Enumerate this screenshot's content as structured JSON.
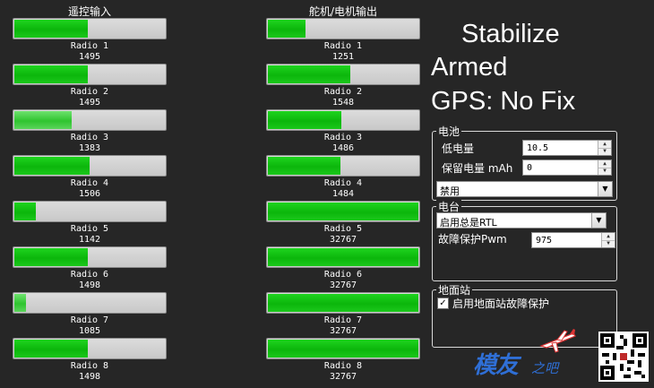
{
  "inputs": {
    "header": "遥控输入",
    "channels": [
      {
        "label": "Radio 1",
        "value": "1495",
        "fill": 0.49
      },
      {
        "label": "Radio 2",
        "value": "1495",
        "fill": 0.49
      },
      {
        "label": "Radio 3",
        "value": "1383",
        "fill": 0.38,
        "soft": true
      },
      {
        "label": "Radio 4",
        "value": "1506",
        "fill": 0.5
      },
      {
        "label": "Radio 5",
        "value": "1142",
        "fill": 0.14
      },
      {
        "label": "Radio 6",
        "value": "1498",
        "fill": 0.49
      },
      {
        "label": "Radio 7",
        "value": "1085",
        "fill": 0.08,
        "soft": true
      },
      {
        "label": "Radio 8",
        "value": "1498",
        "fill": 0.49
      }
    ]
  },
  "outputs": {
    "header": "舵机/电机输出",
    "channels": [
      {
        "label": "Radio 1",
        "value": "1251",
        "fill": 0.25
      },
      {
        "label": "Radio 2",
        "value": "1548",
        "fill": 0.55
      },
      {
        "label": "Radio 3",
        "value": "1486",
        "fill": 0.49
      },
      {
        "label": "Radio 4",
        "value": "1484",
        "fill": 0.48
      },
      {
        "label": "Radio 5",
        "value": "32767",
        "fill": 1.0
      },
      {
        "label": "Radio 6",
        "value": "32767",
        "fill": 1.0
      },
      {
        "label": "Radio 7",
        "value": "32767",
        "fill": 1.0
      },
      {
        "label": "Radio 8",
        "value": "32767",
        "fill": 1.0
      }
    ]
  },
  "status": {
    "mode": "Stabilize",
    "armed": "Armed",
    "gps": "GPS: No Fix"
  },
  "battery": {
    "title": "电池",
    "low_voltage_label": "低电量",
    "low_voltage_value": "10.5",
    "reserve_label": "保留电量 mAh",
    "reserve_value": "0",
    "action_value": "禁用"
  },
  "radio": {
    "title": "电台",
    "mode_value": "启用总是RTL",
    "pwm_label": "故障保护Pwm",
    "pwm_value": "975"
  },
  "gcs": {
    "title": "地面站",
    "checkbox_label": "启用地面站故障保护",
    "checked": true
  },
  "watermark": {
    "logo_text": "模友",
    "logo_sub": "之吧"
  },
  "colors": {
    "background": "#262626",
    "bar_fill": "#0bb60b",
    "bar_track": "#d0d0d0",
    "logo": "#2f6fd6"
  }
}
